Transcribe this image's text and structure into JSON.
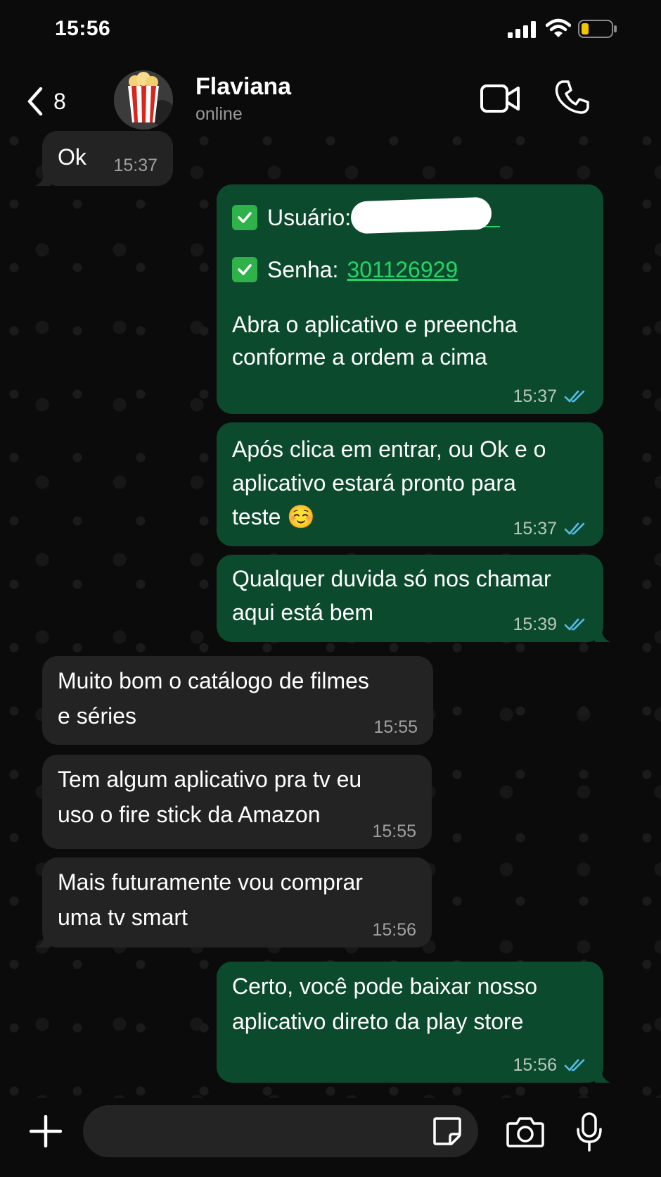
{
  "status_bar": {
    "time": "15:56"
  },
  "header": {
    "back_count": "8",
    "contact_name": "Flaviana",
    "contact_status": "online"
  },
  "messages": [
    {
      "dir": "in",
      "text": "Ok",
      "time": "15:37"
    },
    {
      "dir": "out",
      "user_label": "Usuário:",
      "pass_label": "Senha:",
      "password": "301126929",
      "text": "Abra o aplicativo e preencha\nconforme a ordem a cima",
      "time": "15:37"
    },
    {
      "dir": "out",
      "text": "Após clica em entrar, ou Ok e o\naplicativo estará pronto para\nteste ☺️",
      "time": "15:37"
    },
    {
      "dir": "out",
      "text": "Qualquer duvida só nos chamar\naqui está bem",
      "time": "15:39"
    },
    {
      "dir": "in",
      "text": "Muito bom o catálogo de filmes\ne séries",
      "time": "15:55"
    },
    {
      "dir": "in",
      "text": "Tem algum aplicativo pra tv eu\nuso o fire stick da Amazon",
      "time": "15:55"
    },
    {
      "dir": "in",
      "text": "Mais futuramente vou comprar\numa tv smart",
      "time": "15:56"
    },
    {
      "dir": "out",
      "text": "Certo, você pode baixar nosso\naplicativo direto da play store",
      "time": "15:56"
    }
  ],
  "composer": {
    "placeholder": ""
  },
  "colors": {
    "background": "#0b0b0b",
    "outgoing_bubble": "#0c4a2e",
    "incoming_bubble": "#232323",
    "read_ticks": "#53bdeb",
    "link": "#25d366",
    "battery_low": "#f5c400"
  },
  "icons": [
    "back-chevron-icon",
    "video-call-icon",
    "phone-icon",
    "plus-icon",
    "sticker-icon",
    "camera-icon",
    "microphone-icon",
    "read-receipt-icon",
    "check-emoji-icon"
  ]
}
